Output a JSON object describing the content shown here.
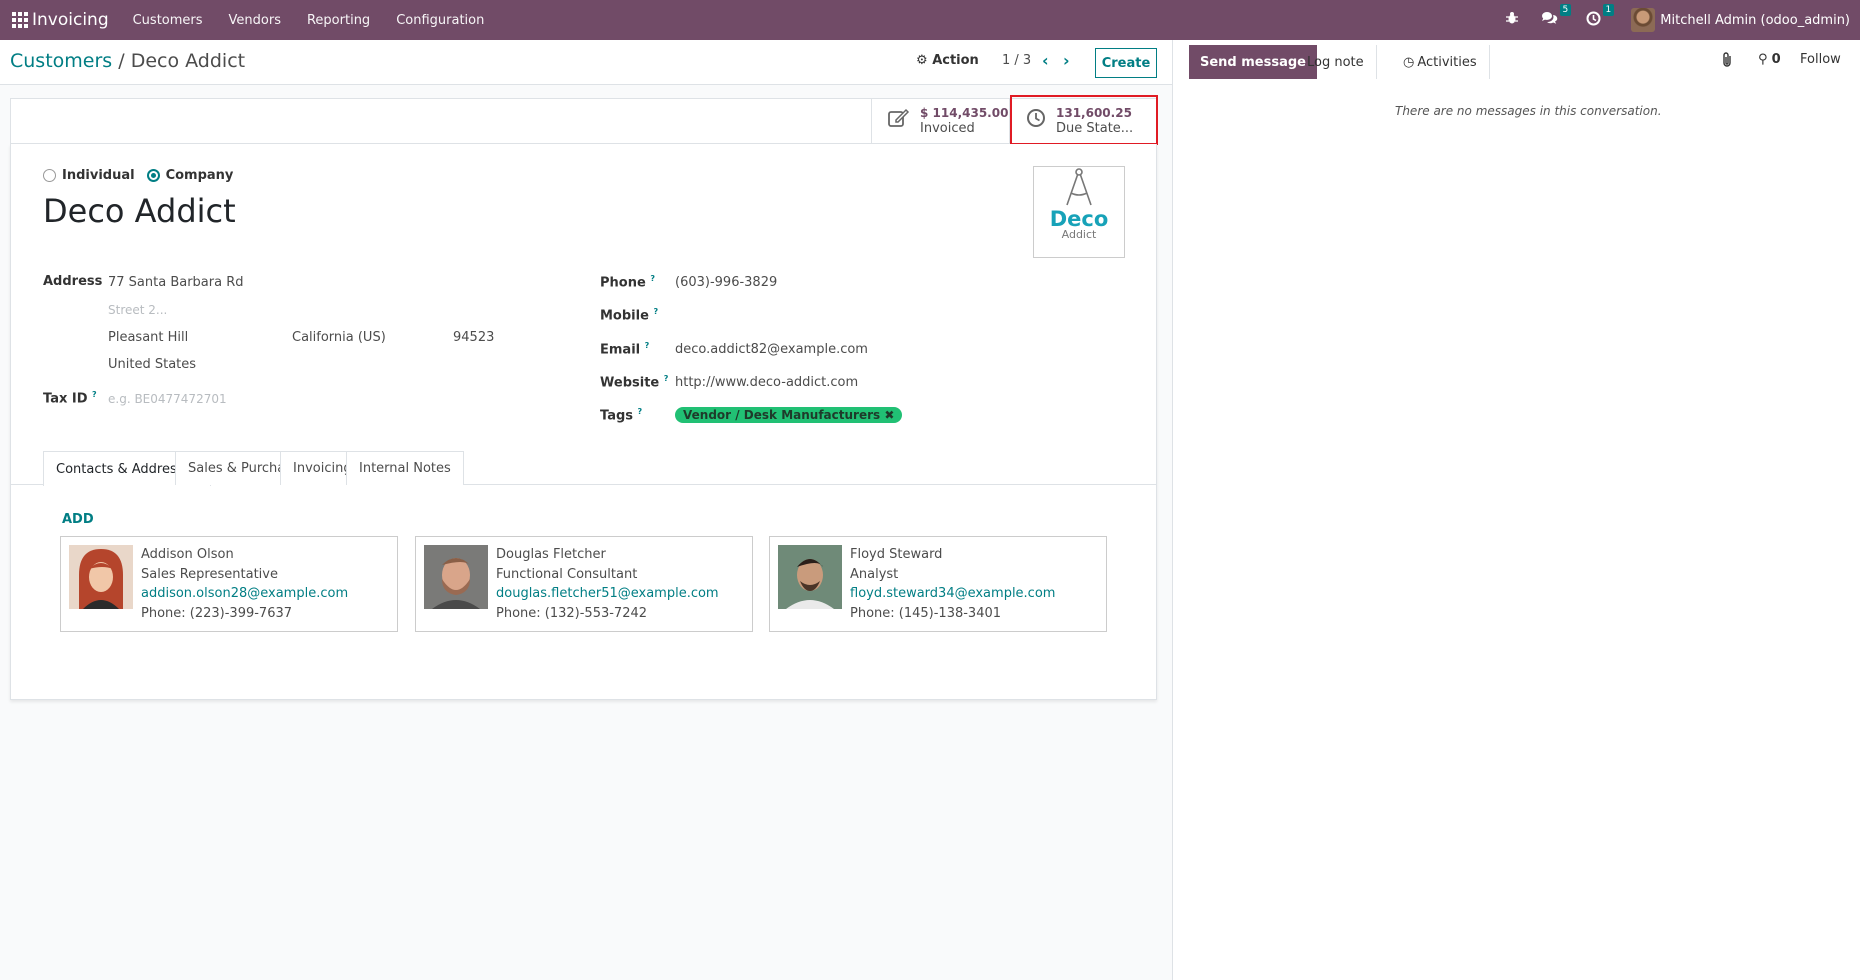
{
  "navbar": {
    "app_name": "Invoicing",
    "menus": [
      "Customers",
      "Vendors",
      "Reporting",
      "Configuration"
    ],
    "messages_badge": "5",
    "activities_badge": "1",
    "user": "Mitchell Admin (odoo_admin)"
  },
  "control": {
    "breadcrumb_parent": "Customers",
    "breadcrumb_sep": "/",
    "breadcrumb_current": "Deco Addict",
    "action_label": "Action",
    "pager": "1 / 3",
    "create_label": "Create"
  },
  "smart_buttons": {
    "invoiced_value": "$ 114,435.00",
    "invoiced_label": "Invoiced",
    "due_value": "131,600.25",
    "due_label": "Due State..."
  },
  "form": {
    "type_individual": "Individual",
    "type_company": "Company",
    "name": "Deco Addict",
    "logo_brand": "Deco",
    "logo_sub": "Addict",
    "address_label": "Address",
    "street": "77 Santa Barbara Rd",
    "street2_placeholder": "Street 2...",
    "city": "Pleasant Hill",
    "state": "California (US)",
    "zip": "94523",
    "country": "United States",
    "taxid_label": "Tax ID",
    "taxid_placeholder": "e.g. BE0477472701",
    "phone_label": "Phone",
    "phone": "(603)-996-3829",
    "mobile_label": "Mobile",
    "email_label": "Email",
    "email": "deco.addict82@example.com",
    "website_label": "Website",
    "website": "http://www.deco-addict.com",
    "tags_label": "Tags",
    "tag": "Vendor / Desk Manufacturers",
    "help_mark": "?"
  },
  "tabs": [
    "Contacts & Addresses",
    "Sales & Purchase",
    "Invoicing",
    "Internal Notes"
  ],
  "contacts": {
    "add_label": "ADD",
    "items": [
      {
        "name": "Addison Olson",
        "title": "Sales Representative",
        "email": "addison.olson28@example.com",
        "phone": "Phone: (223)-399-7637"
      },
      {
        "name": "Douglas Fletcher",
        "title": "Functional Consultant",
        "email": "douglas.fletcher51@example.com",
        "phone": "Phone: (132)-553-7242"
      },
      {
        "name": "Floyd Steward",
        "title": "Analyst",
        "email": "floyd.steward34@example.com",
        "phone": "Phone: (145)-138-3401"
      }
    ]
  },
  "chatter": {
    "send_message": "Send message",
    "log_note": "Log note",
    "activities": "Activities",
    "followers_count": "0",
    "follow": "Follow",
    "empty": "There are no messages in this conversation."
  },
  "colors": {
    "brand": "#714b67",
    "accent": "#017e84",
    "tag": "#21c074",
    "highlight": "#e01b24"
  }
}
